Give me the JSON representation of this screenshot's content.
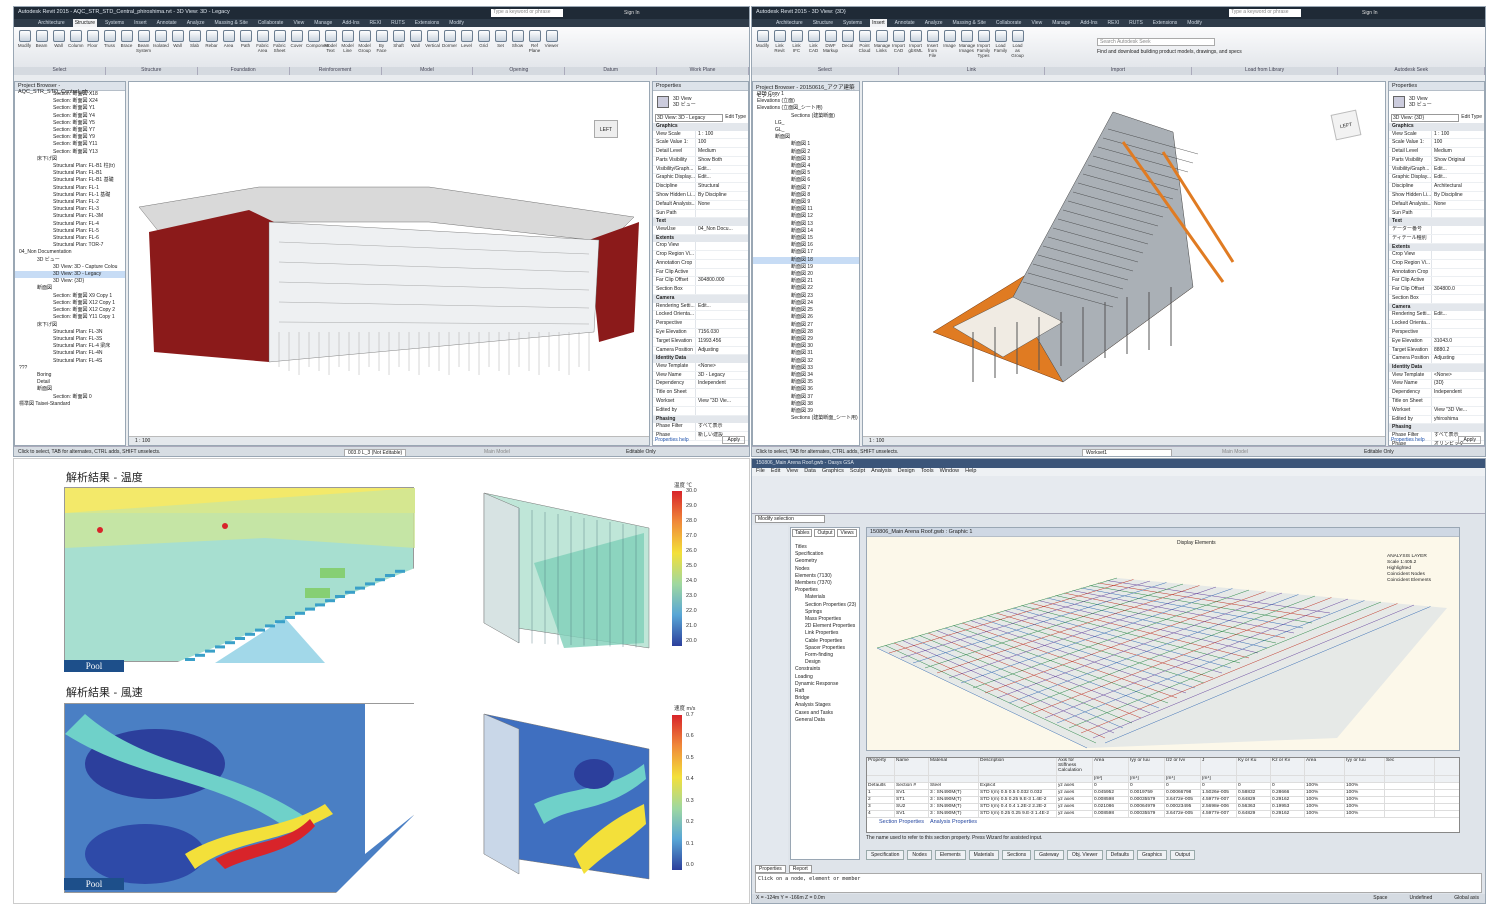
{
  "revit_left": {
    "title": "Autodesk Revit 2015 - AQC_STR_STD_Central_phiroshima.rvt - 3D View: 3D - Legacy",
    "tabs": [
      "Architecture",
      "Structure",
      "Systems",
      "Insert",
      "Annotate",
      "Analyze",
      "Massing & Site",
      "Collaborate",
      "View",
      "Manage",
      "Add-Ins",
      "REXI",
      "RUTS",
      "Extensions",
      "Modify"
    ],
    "active_tab": "Structure",
    "search_placeholder": "Type a keyword or phrase",
    "sign_in": "Sign In",
    "ribbon_buttons": [
      "Modify",
      "Beam",
      "Wall",
      "Column",
      "Floor",
      "Truss",
      "Brace",
      "Beam System",
      "Isolated",
      "Wall",
      "Slab",
      "Rebar",
      "Area",
      "Path",
      "Fabric Area",
      "Fabric Sheet",
      "Cover",
      "Component",
      "Model Text",
      "Model Line",
      "Model Group",
      "By Face",
      "Shaft",
      "Wall",
      "Vertical",
      "Dormer",
      "Level",
      "Grid",
      "Set",
      "Show",
      "Ref Plane",
      "Viewer"
    ],
    "ribbon_groups": [
      "Select",
      "Structure",
      "Foundation",
      "Reinforcement",
      "Model",
      "Opening",
      "Datum",
      "Work Plane"
    ],
    "browser_title": "Project Browser - AQC_STR_STD_Central_ph...",
    "browser_items": [
      "Section: 断面図 X18",
      "Section: 断面図 X24",
      "Section: 断面図 Y1",
      "Section: 断面図 Y4",
      "Section: 断面図 Y5",
      "Section: 断面図 Y7",
      "Section: 断面図 Y9",
      "Section: 断面図 Y11",
      "Section: 断面図 Y13",
      "床下げ図",
      "Structural Plan: FL-B1 柱(tr)",
      "Structural Plan: FL-B1",
      "Structural Plan: FL-B1 基礎",
      "Structural Plan: FL-1",
      "Structural Plan: FL-1 基礎",
      "Structural Plan: FL-2",
      "Structural Plan: FL-3",
      "Structural Plan: FL-3M",
      "Structural Plan: FL-4",
      "Structural Plan: FL-5",
      "Structural Plan: FL-6",
      "Structural Plan: TOR-7",
      "04_Non Documentation",
      "3D ビュー",
      "3D View: 3D - Capture Colou",
      "3D View: 3D - Legacy",
      "3D View: {3D}",
      "断面図",
      "Section: 断面図 X9 Copy 1",
      "Section: 断面図 X12 Copy 1",
      "Section: 断面図 X12 Copy 2",
      "Section: 断面図 Y11 Copy 1",
      "床下げ図",
      "Structural Plan: FL-3N",
      "Structural Plan: FL-3S",
      "Structural Plan: FL-4 梁床",
      "Structural Plan: FL-4N",
      "Structural Plan: FL-4S",
      "???",
      "Boring",
      "Detail",
      "断面図",
      "Section: 断面図 0",
      "標準図 Taisei-Standard"
    ],
    "browser_selected": "3D View: 3D - Legacy",
    "props_title": "Properties",
    "props_type": "3D View",
    "props_type_sub": "3D ビュー",
    "props_selector": "3D View: 3D - Legacy",
    "edit_type": "Edit Type",
    "props": [
      {
        "k": "Graphics",
        "section": true
      },
      {
        "k": "View Scale",
        "v": "1 : 100"
      },
      {
        "k": "Scale Value 1:",
        "v": "100"
      },
      {
        "k": "Detail Level",
        "v": "Medium"
      },
      {
        "k": "Parts Visibility",
        "v": "Show Both"
      },
      {
        "k": "Visibility/Graph...",
        "v": "Edit..."
      },
      {
        "k": "Graphic Display...",
        "v": "Edit..."
      },
      {
        "k": "Discipline",
        "v": "Structural"
      },
      {
        "k": "Show Hidden Li...",
        "v": "By Discipline"
      },
      {
        "k": "Default Analysis...",
        "v": "None"
      },
      {
        "k": "Sun Path",
        "v": ""
      },
      {
        "k": "Text",
        "section": true
      },
      {
        "k": "ViewUse",
        "v": "04_Non Docu..."
      },
      {
        "k": "Extents",
        "section": true
      },
      {
        "k": "Crop View",
        "v": ""
      },
      {
        "k": "Crop Region Vi...",
        "v": ""
      },
      {
        "k": "Annotation Crop",
        "v": ""
      },
      {
        "k": "Far Clip Active",
        "v": ""
      },
      {
        "k": "Far Clip Offset",
        "v": "304800.000"
      },
      {
        "k": "Section Box",
        "v": ""
      },
      {
        "k": "Camera",
        "section": true
      },
      {
        "k": "Rendering Setti...",
        "v": "Edit..."
      },
      {
        "k": "Locked Orienta...",
        "v": ""
      },
      {
        "k": "Perspective",
        "v": ""
      },
      {
        "k": "Eye Elevation",
        "v": "7156.030"
      },
      {
        "k": "Target Elevation",
        "v": "11993.456"
      },
      {
        "k": "Camera Position",
        "v": "Adjusting"
      },
      {
        "k": "Identity Data",
        "section": true
      },
      {
        "k": "View Template",
        "v": "<None>"
      },
      {
        "k": "View Name",
        "v": "3D - Legacy"
      },
      {
        "k": "Dependency",
        "v": "Independent"
      },
      {
        "k": "Title on Sheet",
        "v": ""
      },
      {
        "k": "Workset",
        "v": "View \"3D Vie..."
      },
      {
        "k": "Edited by",
        "v": ""
      },
      {
        "k": "Phasing",
        "section": true
      },
      {
        "k": "Phase Filter",
        "v": "すべて表示"
      },
      {
        "k": "Phase",
        "v": "新しい建設"
      }
    ],
    "props_help": "Properties help",
    "apply": "Apply",
    "scale": "1 : 100",
    "view_cube": "LEFT",
    "status": "Click to select, TAB for alternates, CTRL adds, SHIFT unselects.",
    "workset": "003.0 L_3 (Not Editable)",
    "model": "Main Model",
    "editable_only": "Editable Only"
  },
  "revit_right": {
    "title": "Autodesk Revit 2015 - 3D View: {3D}",
    "tabs": [
      "Architecture",
      "Structure",
      "Systems",
      "Insert",
      "Annotate",
      "Analyze",
      "Massing & Site",
      "Collaborate",
      "View",
      "Manage",
      "Add-Ins",
      "REXI",
      "RUTS",
      "Extensions",
      "Modify"
    ],
    "active_tab": "Insert",
    "search_placeholder": "Type a keyword or phrase",
    "sign_in": "Sign In",
    "ribbon_buttons": [
      "Modify",
      "Link Revit",
      "Link IFC",
      "Link CAD",
      "DWF Markup",
      "Decal",
      "Point Cloud",
      "Manage Links",
      "Import CAD",
      "Import gbXML",
      "Insert from File",
      "Image",
      "Manage Images",
      "Import Family Types",
      "Load Family",
      "Load as Group"
    ],
    "ribbon_groups": [
      "Select",
      "Link",
      "Import",
      "Load from Library",
      "Autodesk Seek"
    ],
    "seek_placeholder": "Search Autodesk Seek",
    "seek_caption": "Find and download building product models, drawings, and specs",
    "browser_title": "Project Browser - 20150616_アクア建築モデル...",
    "browser_items": [
      "{3D} Copy 1",
      "Elevations (立面)",
      "Elevations (立面図_シート用)",
      "Sections (建築断面)",
      "LG_",
      "GL_",
      "断面図",
      "断面図 1",
      "断面図 2",
      "断面図 3",
      "断面図 4",
      "断面図 5",
      "断面図 6",
      "断面図 7",
      "断面図 8",
      "断面図 9",
      "断面図 11",
      "断面図 12",
      "断面図 13",
      "断面図 14",
      "断面図 15",
      "断面図 16",
      "断面図 17",
      "断面図 18",
      "断面図 19",
      "断面図 20",
      "断面図 21",
      "断面図 22",
      "断面図 23",
      "断面図 24",
      "断面図 25",
      "断面図 26",
      "断面図 27",
      "断面図 28",
      "断面図 29",
      "断面図 30",
      "断面図 31",
      "断面図 32",
      "断面図 33",
      "断面図 34",
      "断面図 35",
      "断面図 36",
      "断面図 37",
      "断面図 38",
      "断面図 39",
      "Sections (建築断面_シート用)"
    ],
    "browser_selected": "断面図 18",
    "props_title": "Properties",
    "props_type": "3D View",
    "props_type_sub": "3D ビュー",
    "props_selector": "3D View: {3D}",
    "edit_type": "Edit Type",
    "props": [
      {
        "k": "Graphics",
        "section": true
      },
      {
        "k": "View Scale",
        "v": "1 : 100"
      },
      {
        "k": "Scale Value 1:",
        "v": "100"
      },
      {
        "k": "Detail Level",
        "v": "Medium"
      },
      {
        "k": "Parts Visibility",
        "v": "Show Original"
      },
      {
        "k": "Visibility/Graph...",
        "v": "Edit..."
      },
      {
        "k": "Graphic Display...",
        "v": "Edit..."
      },
      {
        "k": "Discipline",
        "v": "Architectural"
      },
      {
        "k": "Show Hidden Li...",
        "v": "By Discipline"
      },
      {
        "k": "Default Analysis...",
        "v": "None"
      },
      {
        "k": "Sun Path",
        "v": ""
      },
      {
        "k": "Text",
        "section": true
      },
      {
        "k": "データー番号",
        "v": ""
      },
      {
        "k": "ディテール種別",
        "v": ""
      },
      {
        "k": "Extents",
        "section": true
      },
      {
        "k": "Crop View",
        "v": ""
      },
      {
        "k": "Crop Region Vi...",
        "v": ""
      },
      {
        "k": "Annotation Crop",
        "v": ""
      },
      {
        "k": "Far Clip Active",
        "v": ""
      },
      {
        "k": "Far Clip Offset",
        "v": "304800.0"
      },
      {
        "k": "Section Box",
        "v": ""
      },
      {
        "k": "Camera",
        "section": true
      },
      {
        "k": "Rendering Setti...",
        "v": "Edit..."
      },
      {
        "k": "Locked Orienta...",
        "v": ""
      },
      {
        "k": "Perspective",
        "v": ""
      },
      {
        "k": "Eye Elevation",
        "v": "31043.0"
      },
      {
        "k": "Target Elevation",
        "v": "8880.2"
      },
      {
        "k": "Camera Position",
        "v": "Adjusting"
      },
      {
        "k": "Identity Data",
        "section": true
      },
      {
        "k": "View Template",
        "v": "<None>"
      },
      {
        "k": "View Name",
        "v": "{3D}"
      },
      {
        "k": "Dependency",
        "v": "Independent"
      },
      {
        "k": "Title on Sheet",
        "v": ""
      },
      {
        "k": "Workset",
        "v": "View \"3D Vie..."
      },
      {
        "k": "Edited by",
        "v": "yhiroshima"
      },
      {
        "k": "Phasing",
        "section": true
      },
      {
        "k": "Phase Filter",
        "v": "すべて表示"
      },
      {
        "k": "Phase",
        "v": "オリンピック"
      }
    ],
    "props_help": "Properties help",
    "apply": "Apply",
    "scale": "1 : 100",
    "view_cube": "LEFT",
    "status": "Click to select, TAB for alternates, CTRL adds, SHIFT unselects.",
    "workset": "Workset1",
    "model": "Main Model",
    "editable_only": "Editable Only"
  },
  "cfd": {
    "temp_title": "解析結果 - 温度",
    "wind_title": "解析結果 - 風速",
    "temp_unit": "温度 ℃",
    "wind_unit": "速度 m/s",
    "temp_ticks": [
      "30.0",
      "29.0",
      "28.0",
      "27.0",
      "26.0",
      "25.0",
      "24.0",
      "23.0",
      "22.0",
      "21.0",
      "20.0"
    ],
    "wind_ticks": [
      "0.7",
      "0.6",
      "0.5",
      "0.4",
      "0.3",
      "0.2",
      "0.1",
      "0.0"
    ],
    "pool_label": "Pool",
    "colors": {
      "hot": "#d8242a",
      "warm": "#f3e03a",
      "mid": "#8fd3b0",
      "cool": "#58a6d6",
      "cold": "#2c3f9c"
    }
  },
  "gsa": {
    "title": "150806_Main Arena Roof.gwb - Oasys GSA",
    "menu": [
      "File",
      "Edit",
      "View",
      "Data",
      "Graphics",
      "Sculpt",
      "Analysis",
      "Design",
      "Tools",
      "Window",
      "Help"
    ],
    "selection": "Modify selection",
    "graphic_title": "150806_Main Arena Roof.gwb : Graphic 1",
    "graphic_toolbar": "Display  Elements",
    "panel_tabs": [
      "Tables",
      "Output",
      "Views"
    ],
    "tree": [
      "Titles",
      "Specification",
      "Geometry",
      "Nodes",
      "Elements (7130)",
      "Members (7370)",
      "Properties",
      "Materials",
      "Section Properties (23)",
      "Springs",
      "Mass Properties",
      "2D Element Properties",
      "Link Properties",
      "Cable Properties",
      "Spacer Properties",
      "Form-finding",
      "Design",
      "Constraints",
      "Loading",
      "Dynamic Response",
      "Raft",
      "Bridge",
      "Analysis Stages",
      "Cases and Tasks",
      "General Data"
    ],
    "legend": [
      "ANALYSIS LAYER",
      "Scale 1:405.2",
      "Highlighted",
      "Coincident Nodes",
      "Coincident Elements"
    ],
    "table_cols": [
      "Property",
      "Name",
      "Material",
      "Description",
      "Axis for Stiffness Calculation",
      "Area",
      "Iyy or Iuu",
      "Izz or Ivv",
      "J",
      "Ky or Ku",
      "Kz or Kv",
      "Area",
      "Iyy or Iuu",
      "Sec"
    ],
    "table_units": [
      "",
      "",
      "",
      "",
      "",
      "[m²]",
      "[m⁴]",
      "[m⁴]",
      "[m⁴]",
      "",
      "",
      "",
      "",
      ""
    ],
    "table_rows": [
      [
        "Defaults",
        "Section #",
        "Steel",
        "Explicit",
        "yz axes",
        "0",
        "0",
        "0",
        "0",
        "0",
        "0",
        "100%",
        "100%",
        ""
      ],
      [
        "1",
        "SV1",
        "3 : SN490M(T)",
        "STD I(m) 0.5 0.5 0.032 0.032",
        "yz axes",
        "0.045952",
        "0.0019759",
        "0.00066798",
        "1.5026e-005",
        "0.58832",
        "0.28666",
        "100%",
        "100%",
        ""
      ],
      [
        "2",
        "ST1",
        "3 : SN490M(T)",
        "STD I(m) 0.5 0.25 9.E-3 1.4E-2",
        "yz axes",
        "0.008598",
        "0.00035579",
        "3.6472e-005",
        "4.5977e-007",
        "0.64829",
        "0.29162",
        "100%",
        "100%",
        ""
      ],
      [
        "3",
        "SU2",
        "3 : SN490M(T)",
        "STD I(m) 0.4 0.4 1.2E-2 2.2E-2",
        "yz axes",
        "0.021086",
        "0.00064979",
        "0.00023495",
        "2.5698e-006",
        "0.56363",
        "0.19953",
        "100%",
        "100%",
        ""
      ],
      [
        "4",
        "SV1",
        "3 : SN490M(T)",
        "STD I(m) 0.25 0.25 9.E-3 1.4E-2",
        "yz axes",
        "0.008598",
        "0.00035579",
        "3.6472e-005",
        "4.5977e-007",
        "0.64829",
        "0.29162",
        "100%",
        "100%",
        ""
      ]
    ],
    "table_tabs": [
      "Section Properties",
      "Analysis Properties"
    ],
    "hint": "The name used to refer to this section property. Press Wizard for assisted input.",
    "buttons": [
      "Specification",
      "Nodes",
      "Elements",
      "Materials",
      "Sections",
      "Gateway",
      "Obj. Viewer",
      "Defaults",
      "Graphics",
      "Output"
    ],
    "out_tabs": [
      "Properties",
      "Report"
    ],
    "output_text": "Click on a node, element or member",
    "status": "X = -124m  Y = -166m  Z = 0.0m",
    "status_right": [
      "Space",
      "Undefined",
      "Global axis"
    ]
  }
}
